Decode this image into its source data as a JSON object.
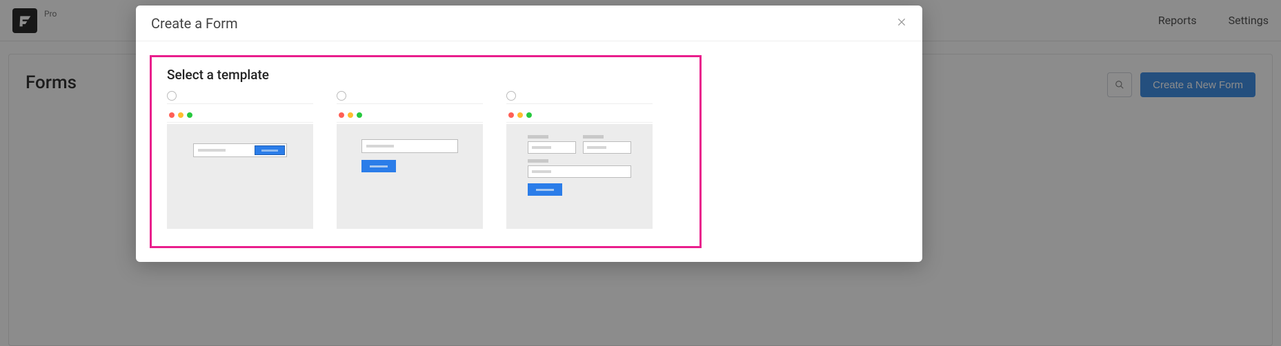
{
  "topbar": {
    "badge": "Pro",
    "nav": {
      "reports": "Reports",
      "settings": "Settings"
    }
  },
  "page": {
    "title": "Forms",
    "create_button": "Create a New Form"
  },
  "modal": {
    "title": "Create a Form",
    "section_title": "Select a template"
  }
}
